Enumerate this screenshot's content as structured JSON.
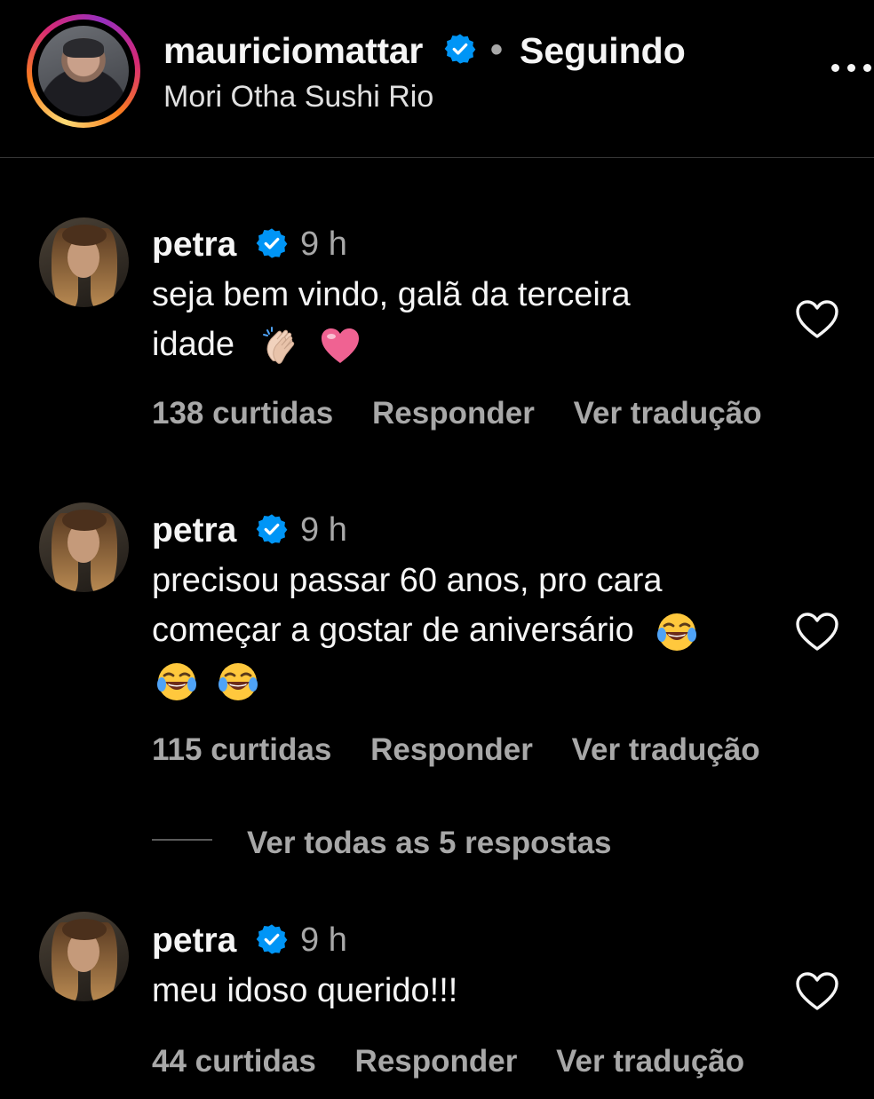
{
  "header": {
    "username": "mauriciomattar",
    "separator": "•",
    "follow_status": "Seguindo",
    "location": "Mori Otha Sushi Rio",
    "more_icon": "more-horizontal-icon"
  },
  "comments": [
    {
      "user": "petra",
      "time": "9 h",
      "text_line1": "seja bem vindo, galã da terceira",
      "text_line2": "idade",
      "emojis": [
        "clapping-hands-emoji",
        "pink-heart-emoji"
      ],
      "likes": "138 curtidas",
      "reply": "Responder",
      "translate": "Ver tradução"
    },
    {
      "user": "petra",
      "time": "9 h",
      "text_line1": "precisou passar 60 anos, pro cara",
      "text_line2": "começar a gostar de aniversário",
      "emojis": [
        "tears-of-joy-emoji",
        "tears-of-joy-emoji",
        "tears-of-joy-emoji"
      ],
      "likes": "115 curtidas",
      "reply": "Responder",
      "translate": "Ver tradução"
    },
    {
      "user": "petra",
      "time": "9 h",
      "text_line1": "meu idoso querido!!!",
      "likes": "44 curtidas",
      "reply": "Responder",
      "translate": "Ver tradução"
    }
  ],
  "view_replies": "Ver todas as 5 respostas",
  "colors": {
    "background": "#000000",
    "verified": "#0095f6",
    "secondary_text": "#a8a8a8"
  }
}
